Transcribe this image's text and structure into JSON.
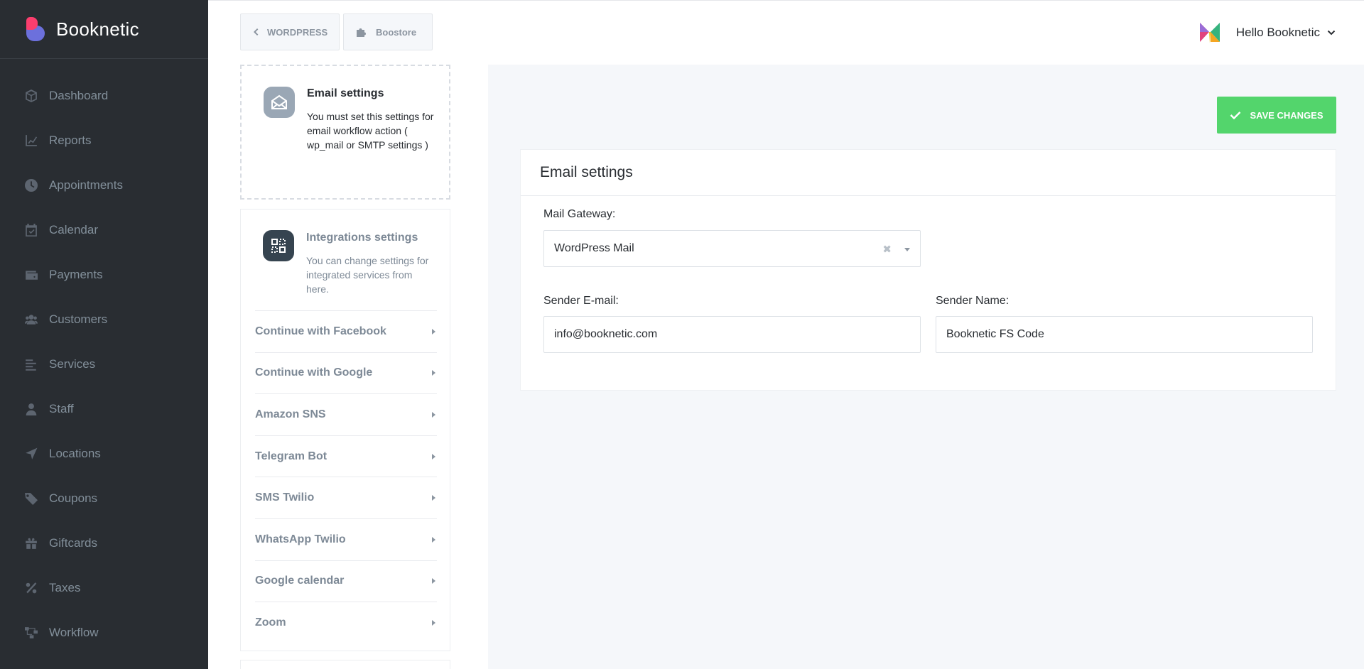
{
  "brand": {
    "name": "Booknetic"
  },
  "sidebar": {
    "items": [
      {
        "label": "Dashboard",
        "icon": "cube-icon"
      },
      {
        "label": "Reports",
        "icon": "chart-line-icon"
      },
      {
        "label": "Appointments",
        "icon": "clock-icon"
      },
      {
        "label": "Calendar",
        "icon": "calendar-check-icon"
      },
      {
        "label": "Payments",
        "icon": "wallet-icon"
      },
      {
        "label": "Customers",
        "icon": "users-icon"
      },
      {
        "label": "Services",
        "icon": "list-icon"
      },
      {
        "label": "Staff",
        "icon": "user-icon"
      },
      {
        "label": "Locations",
        "icon": "location-arrow-icon"
      },
      {
        "label": "Coupons",
        "icon": "tag-icon"
      },
      {
        "label": "Giftcards",
        "icon": "gift-icon"
      },
      {
        "label": "Taxes",
        "icon": "percent-icon"
      },
      {
        "label": "Workflow",
        "icon": "workflow-icon"
      }
    ]
  },
  "header": {
    "wordpress_label": "WORDPRESS",
    "boostore_label": "Boostore",
    "user_greeting": "Hello Booknetic"
  },
  "settings_menu": {
    "email": {
      "title": "Email settings",
      "description": "You must set this settings for email workflow action ( wp_mail or SMTP settings )"
    },
    "integrations": {
      "title": "Integrations settings",
      "description": "You can change settings for integrated services from here.",
      "items": [
        "Continue with Facebook",
        "Continue with Google",
        "Amazon SNS",
        "Telegram Bot",
        "SMS Twilio",
        "WhatsApp Twilio",
        "Google calendar",
        "Zoom"
      ]
    }
  },
  "main": {
    "save_label": "SAVE CHANGES",
    "panel_title": "Email settings",
    "mail_gateway_label": "Mail Gateway:",
    "mail_gateway_value": "WordPress Mail",
    "sender_email_label": "Sender E-mail:",
    "sender_email_value": "info@booknetic.com",
    "sender_name_label": "Sender Name:",
    "sender_name_value": "Booknetic FS Code"
  },
  "colors": {
    "sidebar_bg": "#292d32",
    "save_button": "#53d56c",
    "brand_pink": "#fb3e6e",
    "brand_purple": "#6c70dc"
  }
}
